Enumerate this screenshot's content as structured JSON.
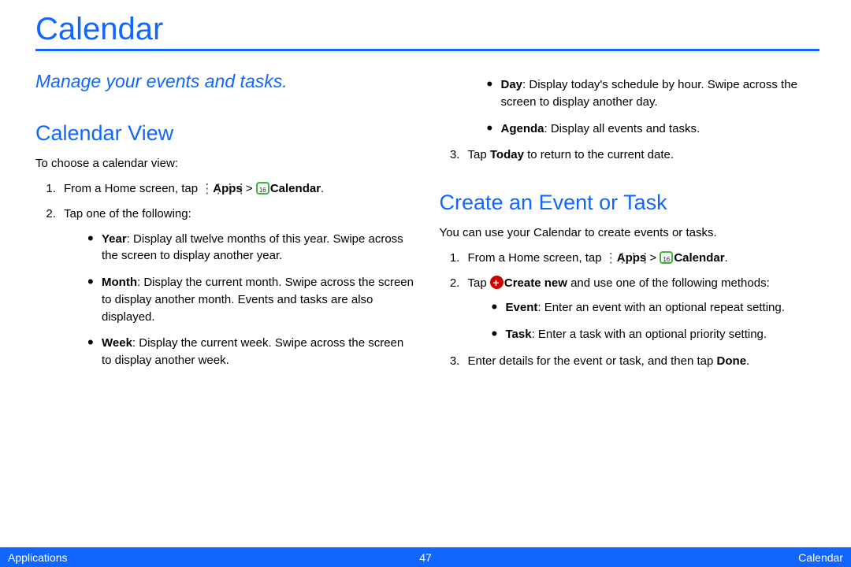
{
  "title": "Calendar",
  "subtitle": "Manage your events and tasks.",
  "section_view": {
    "heading": "Calendar View",
    "intro": "To choose a calendar view:",
    "step1_a": "From a Home screen, tap ",
    "apps_label": "Apps",
    "gt": " > ",
    "cal_label": "Calendar",
    "period": ".",
    "step2": "Tap one of the following:",
    "year_b": "Year",
    "year_t": ": Display all twelve months of this year. Swipe across the screen to display another year.",
    "month_b": "Month",
    "month_t": ": Display the current month. Swipe across the screen to display another month. Events and tasks are also displayed.",
    "week_b": "Week",
    "week_t": ": Display the current week. Swipe across the screen to display another week.",
    "day_b": "Day",
    "day_t": ": Display today's schedule by hour. Swipe across the screen to display another day.",
    "agenda_b": "Agenda",
    "agenda_t": ": Display all events and tasks.",
    "step3_a": "Tap ",
    "today_b": "Today",
    "step3_c": " to return to the current date."
  },
  "section_create": {
    "heading": "Create an Event or Task",
    "intro": "You can use your Calendar to create events or tasks.",
    "step1_a": "From a Home screen, tap ",
    "step2_a": "Tap ",
    "create_b": "Create new",
    "step2_c": " and use one of the following methods:",
    "event_b": "Event",
    "event_t": ": Enter an event with an optional repeat setting.",
    "task_b": "Task",
    "task_t": ": Enter a task with an optional priority setting.",
    "step3_a": "Enter details for the event or task, and then tap ",
    "done_b": "Done"
  },
  "footer": {
    "left": "Applications",
    "center": "47",
    "right": "Calendar"
  }
}
